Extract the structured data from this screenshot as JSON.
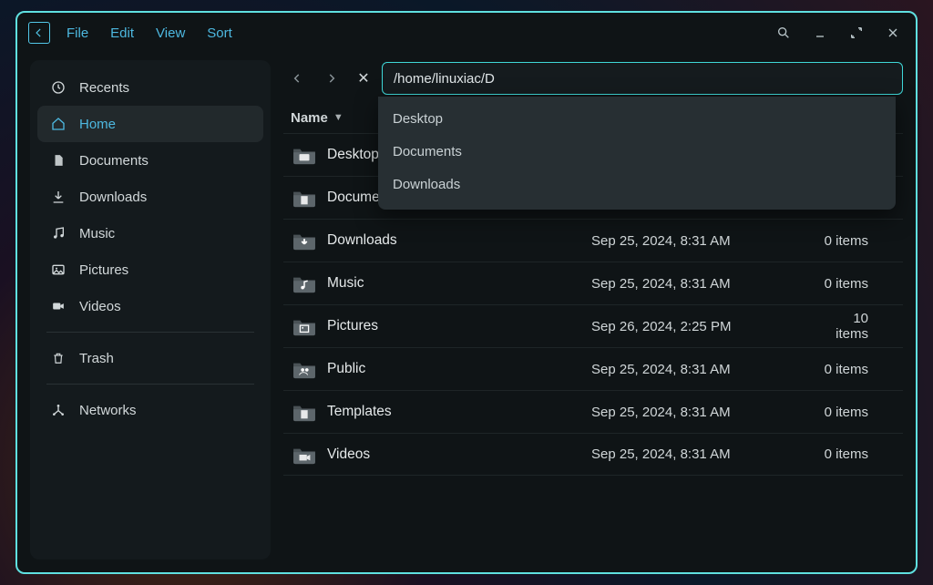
{
  "menu": {
    "file": "File",
    "edit": "Edit",
    "view": "View",
    "sort": "Sort"
  },
  "path": {
    "value": "/home/linuxiac/D"
  },
  "suggestions": [
    "Desktop",
    "Documents",
    "Downloads"
  ],
  "columns": {
    "name": "Name"
  },
  "sidebar": {
    "recents": "Recents",
    "home": "Home",
    "documents": "Documents",
    "downloads": "Downloads",
    "music": "Music",
    "pictures": "Pictures",
    "videos": "Videos",
    "trash": "Trash",
    "networks": "Networks"
  },
  "rows": [
    {
      "name": "Desktop",
      "date": "",
      "items": ""
    },
    {
      "name": "Documen",
      "date": "",
      "items": ""
    },
    {
      "name": "Downloads",
      "date": "Sep 25, 2024, 8:31 AM",
      "items": "0 items"
    },
    {
      "name": "Music",
      "date": "Sep 25, 2024, 8:31 AM",
      "items": "0 items"
    },
    {
      "name": "Pictures",
      "date": "Sep 26, 2024, 2:25 PM",
      "items": "10 items"
    },
    {
      "name": "Public",
      "date": "Sep 25, 2024, 8:31 AM",
      "items": "0 items"
    },
    {
      "name": "Templates",
      "date": "Sep 25, 2024, 8:31 AM",
      "items": "0 items"
    },
    {
      "name": "Videos",
      "date": "Sep 25, 2024, 8:31 AM",
      "items": "0 items"
    }
  ],
  "row_icons": [
    "display",
    "file",
    "download",
    "music",
    "image",
    "people",
    "file",
    "video"
  ]
}
